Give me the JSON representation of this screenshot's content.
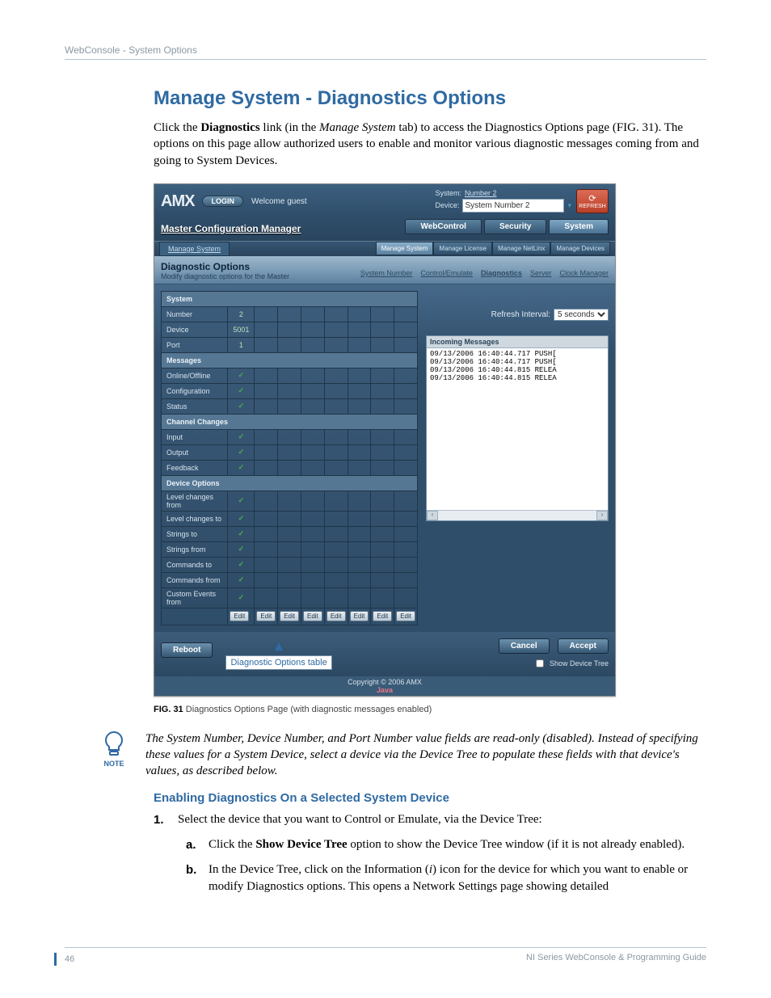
{
  "running_header": "WebConsole - System Options",
  "title": "Manage System - Diagnostics Options",
  "intro": "Click the Diagnostics link (in the Manage System tab) to access the Diagnostics Options page (FIG. 31). The options on this page allow authorized users to enable and monitor various diagnostic messages coming from and going to System Devices.",
  "shot": {
    "logo": "AMX",
    "login_btn": "LOGIN",
    "welcome": "Welcome guest",
    "system_label": "System:",
    "system_value": "Number 2",
    "device_label": "Device:",
    "device_value": "System Number 2",
    "refresh_btn": "REFRESH",
    "main_title": "Master Configuration Manager",
    "big_tabs": [
      "WebControl",
      "Security",
      "System"
    ],
    "crumb": "Manage System",
    "mini_tabs": [
      "Manage System",
      "Manage License",
      "Manage NetLinx",
      "Manage Devices"
    ],
    "panel_title": "Diagnostic Options",
    "panel_sub": "Modify diagnostic options for the Master",
    "sublinks": [
      "System Number",
      "Control/Emulate",
      "Diagnostics",
      "Server",
      "Clock Manager"
    ],
    "table": {
      "sections": [
        {
          "header": "System",
          "rows": [
            {
              "label": "Number",
              "value": "2"
            },
            {
              "label": "Device",
              "value": "5001"
            },
            {
              "label": "Port",
              "value": "1"
            }
          ]
        },
        {
          "header": "Messages",
          "rows": [
            {
              "label": "Online/Offline",
              "check": true
            },
            {
              "label": "Configuration",
              "check": true
            },
            {
              "label": "Status",
              "check": true
            }
          ]
        },
        {
          "header": "Channel Changes",
          "rows": [
            {
              "label": "Input",
              "check": true
            },
            {
              "label": "Output",
              "check": true
            },
            {
              "label": "Feedback",
              "check": true
            }
          ]
        },
        {
          "header": "Device Options",
          "rows": [
            {
              "label": "Level changes from",
              "check": true
            },
            {
              "label": "Level changes to",
              "check": true
            },
            {
              "label": "Strings to",
              "check": true
            },
            {
              "label": "Strings from",
              "check": true
            },
            {
              "label": "Commands to",
              "check": true
            },
            {
              "label": "Commands from",
              "check": true
            },
            {
              "label": "Custom Events from",
              "check": true
            }
          ]
        }
      ],
      "edit_label": "Edit",
      "edit_count": 8
    },
    "refresh_interval_label": "Refresh Interval:",
    "refresh_interval_value": "5 seconds",
    "incoming_header": "Incoming Messages",
    "incoming_lines": [
      "09/13/2006 16:40:44.717 PUSH[",
      "09/13/2006 16:40:44.717 PUSH[",
      "09/13/2006 16:40:44.815 RELEA",
      "09/13/2006 16:40:44.815 RELEA"
    ],
    "callout": "Diagnostic Options table",
    "reboot_btn": "Reboot",
    "cancel_btn": "Cancel",
    "accept_btn": "Accept",
    "copyright": "Copyright © 2006 AMX",
    "java_badge": "Java",
    "device_tree_label": "Show Device Tree"
  },
  "fig_caption_bold": "FIG. 31",
  "fig_caption_rest": "  Diagnostics Options Page (with diagnostic messages enabled)",
  "note_label": "NOTE",
  "note_text": "The System Number, Device Number, and Port Number value fields are read-only (disabled). Instead of specifying these values for a System Device, select a device via the Device Tree to populate these fields with that device's values, as described below.",
  "section2_title": "Enabling Diagnostics On a Selected System Device",
  "step1_num": "1.",
  "step1_text": "Select the device that you want to Control or Emulate, via the Device Tree:",
  "step_a_let": "a.",
  "step_a_text_pre": "Click the ",
  "step_a_bold": "Show Device Tree",
  "step_a_text_post": " option to show the Device Tree window (if it is not already enabled).",
  "step_b_let": "b.",
  "step_b_text": "In the Device Tree, click on the Information (i) icon for the device for which you want to enable or modify Diagnostics options. This opens a Network Settings page showing detailed",
  "page_number": "46",
  "footer_right": "NI Series WebConsole & Programming Guide"
}
